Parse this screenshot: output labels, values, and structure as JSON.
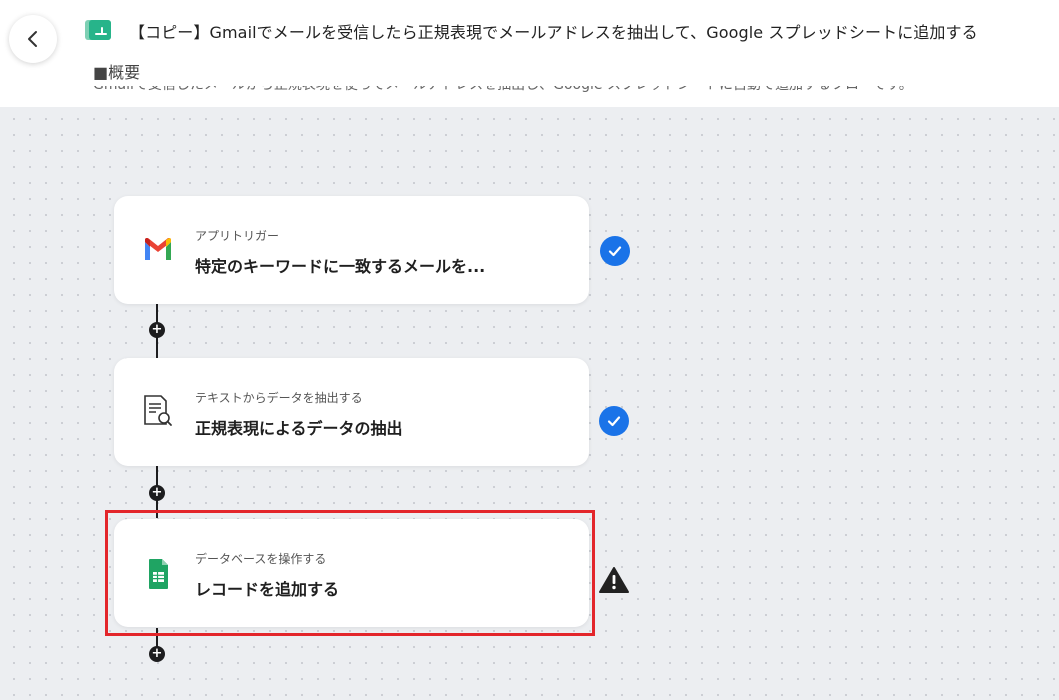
{
  "header": {
    "title": "【コピー】Gmailでメールを受信したら正規表現でメールアドレスを抽出して、Google スプレッドシートに追加する",
    "overview_label": "■概要",
    "description_preview": "Gmailで受信したメールから正規表現を使ってメールアドレスを抽出し、Google スプレッドシートに自動で追加するフローです。"
  },
  "steps": [
    {
      "category": "アプリトリガー",
      "action": "特定のキーワードに一致するメールを...",
      "icon": "gmail-icon",
      "status": "complete"
    },
    {
      "category": "テキストからデータを抽出する",
      "action": "正規表現によるデータの抽出",
      "icon": "text-extract-icon",
      "status": "complete"
    },
    {
      "category": "データベースを操作する",
      "action": "レコードを追加する",
      "icon": "google-sheets-icon",
      "status": "warning"
    }
  ],
  "colors": {
    "check": "#1a73e8",
    "warning": "#222222",
    "highlight": "#e3262b"
  }
}
